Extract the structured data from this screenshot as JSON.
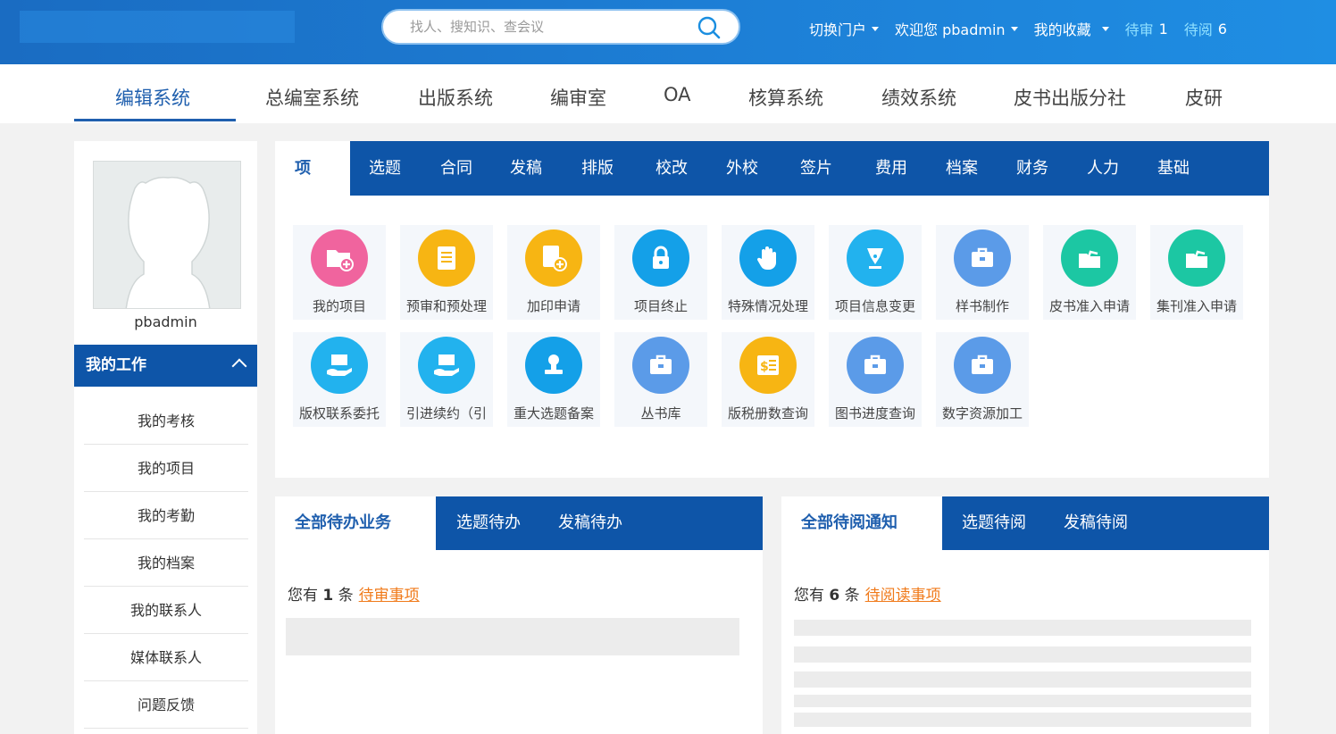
{
  "header": {
    "search_placeholder": "找人、搜知识、查会议",
    "links": {
      "switch_portal": "切换门户",
      "welcome": "欢迎您 pbadmin",
      "favorites": "我的收藏",
      "pending_review_label": "待审",
      "pending_review_count": "1",
      "pending_read_label": "待阅",
      "pending_read_count": "6"
    }
  },
  "system_tabs": [
    "编辑系统",
    "总编室系统",
    "出版系统",
    "编审室",
    "OA",
    "核算系统",
    "绩效系统",
    "皮书出版分社",
    "皮研"
  ],
  "sidebar": {
    "username": "pbadmin",
    "section_title": "我的工作",
    "items": [
      "我的考核",
      "我的项目",
      "我的考勤",
      "我的档案",
      "我的联系人",
      "媒体联系人",
      "问题反馈"
    ]
  },
  "module_tabs": [
    "项",
    "选题",
    "合同",
    "发稿",
    "排版",
    "校改",
    "外校",
    "签片",
    "费用",
    "档案",
    "财务",
    "人力",
    "基础"
  ],
  "tiles": [
    {
      "label": "我的项目",
      "icon": "folder-add-icon",
      "color": "#f0649e"
    },
    {
      "label": "预审和预处理",
      "icon": "document-icon",
      "color": "#f7b513"
    },
    {
      "label": "加印申请",
      "icon": "file-add-icon",
      "color": "#f7b513"
    },
    {
      "label": "项目终止",
      "icon": "lock-icon",
      "color": "#14a0e8"
    },
    {
      "label": "特殊情况处理",
      "icon": "hand-icon",
      "color": "#14a0e8"
    },
    {
      "label": "项目信息变更",
      "icon": "pen-icon",
      "color": "#22b2ee"
    },
    {
      "label": "样书制作",
      "icon": "briefcase-icon",
      "color": "#5b9be8"
    },
    {
      "label": "皮书准入申请",
      "icon": "open-folder-icon",
      "color": "#1cc7a3"
    },
    {
      "label": "集刊准入申请",
      "icon": "open-folder-icon",
      "color": "#1cc7a3"
    },
    {
      "label": "版权联系委托",
      "icon": "hand-shop-icon",
      "color": "#22b2ee"
    },
    {
      "label": "引进续约（引",
      "icon": "hand-shop-icon",
      "color": "#22b2ee"
    },
    {
      "label": "重大选题备案",
      "icon": "stamp-icon",
      "color": "#14a0e8"
    },
    {
      "label": "丛书库",
      "icon": "briefcase-icon",
      "color": "#5b9be8"
    },
    {
      "label": "版税册数查询",
      "icon": "receipt-icon",
      "color": "#f7b513"
    },
    {
      "label": "图书进度查询",
      "icon": "briefcase-icon",
      "color": "#5b9be8"
    },
    {
      "label": "数字资源加工",
      "icon": "briefcase-icon",
      "color": "#5b9be8"
    }
  ],
  "todo_panel": {
    "active_tab": "全部待办业务",
    "tabs": [
      "选题待办",
      "发稿待办"
    ],
    "notice_prefix": "您有",
    "notice_count": "1",
    "notice_unit": "条",
    "notice_link": "待审事项"
  },
  "read_panel": {
    "active_tab": "全部待阅通知",
    "tabs": [
      "选题待阅",
      "发稿待阅"
    ],
    "notice_prefix": "您有",
    "notice_count": "6",
    "notice_unit": "条",
    "notice_link": "待阅读事项"
  },
  "colors": {
    "primary": "#0e55a8",
    "accent_link": "#f07a1a",
    "header_gradient_start": "#1a6cc2"
  }
}
